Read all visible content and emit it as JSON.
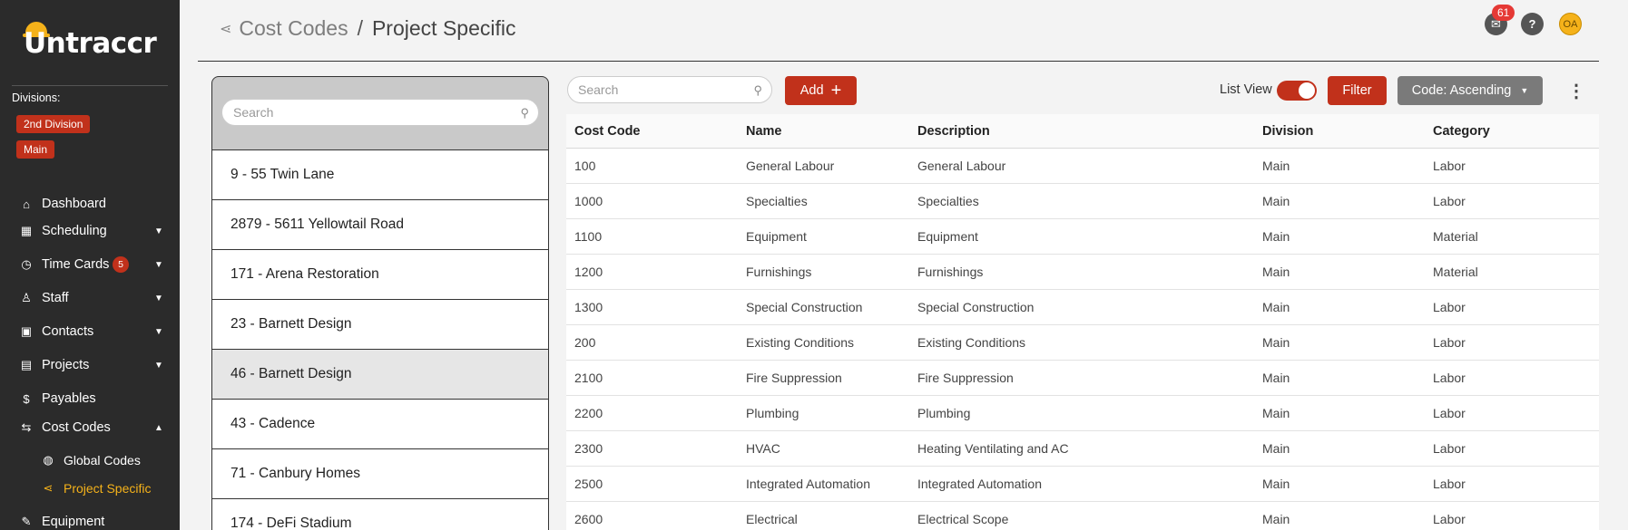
{
  "sidebar": {
    "logo_text": "Untraccr",
    "divisions_label": "Divisions:",
    "divisions": [
      "2nd Division",
      "Main"
    ],
    "nav": [
      {
        "label": "Dashboard",
        "icon": "home-icon"
      },
      {
        "label": "Scheduling",
        "icon": "calendar-icon",
        "expandable": true
      },
      {
        "label": "Time Cards",
        "icon": "clock-icon",
        "badge": "5",
        "expandable": true
      },
      {
        "label": "Staff",
        "icon": "person-icon",
        "expandable": true
      },
      {
        "label": "Contacts",
        "icon": "contacts-icon",
        "expandable": true
      },
      {
        "label": "Projects",
        "icon": "projects-icon",
        "expandable": true
      },
      {
        "label": "Payables",
        "icon": "dollar-icon"
      },
      {
        "label": "Cost Codes",
        "icon": "swap-icon",
        "expanded": true
      },
      {
        "label": "Global Codes",
        "icon": "globe-icon",
        "sub": true
      },
      {
        "label": "Project Specific",
        "icon": "share-icon",
        "sub": true,
        "active": true
      },
      {
        "label": "Equipment",
        "icon": "wrench-icon"
      }
    ]
  },
  "header": {
    "breadcrumb_root": "Cost Codes",
    "breadcrumb_sep": "/",
    "breadcrumb_current": "Project Specific",
    "mail_badge": "61",
    "help_label": "?",
    "avatar_initials": "OA"
  },
  "projects": {
    "search_placeholder": "Search",
    "items": [
      "9 - 55 Twin Lane",
      "2879 - 5611 Yellowtail Road",
      "171 - Arena Restoration",
      "23 - Barnett Design",
      "46 - Barnett Design",
      "43 - Cadence",
      "71 - Canbury Homes",
      "174 - DeFi Stadium"
    ],
    "selected_index": 4
  },
  "toolbar": {
    "search_placeholder": "Search",
    "add_label": "Add",
    "list_view_label": "List View",
    "list_view_on": true,
    "filter_label": "Filter",
    "sort_label": "Code: Ascending"
  },
  "table": {
    "columns": [
      "Cost Code",
      "Name",
      "Description",
      "Division",
      "Category"
    ],
    "rows": [
      [
        "100",
        "General Labour",
        "General Labour",
        "Main",
        "Labor"
      ],
      [
        "1000",
        "Specialties",
        "Specialties",
        "Main",
        "Labor"
      ],
      [
        "1100",
        "Equipment",
        "Equipment",
        "Main",
        "Material"
      ],
      [
        "1200",
        "Furnishings",
        "Furnishings",
        "Main",
        "Material"
      ],
      [
        "1300",
        "Special Construction",
        "Special Construction",
        "Main",
        "Labor"
      ],
      [
        "200",
        "Existing Conditions",
        "Existing Conditions",
        "Main",
        "Labor"
      ],
      [
        "2100",
        "Fire Suppression",
        "Fire Suppression",
        "Main",
        "Labor"
      ],
      [
        "2200",
        "Plumbing",
        "Plumbing",
        "Main",
        "Labor"
      ],
      [
        "2300",
        "HVAC",
        "Heating Ventilating and AC",
        "Main",
        "Labor"
      ],
      [
        "2500",
        "Integrated Automation",
        "Integrated Automation",
        "Main",
        "Labor"
      ],
      [
        "2600",
        "Electrical",
        "Electrical Scope",
        "Main",
        "Labor"
      ]
    ]
  },
  "colors": {
    "accent_red": "#c1311b",
    "accent_yellow": "#f5b21a",
    "sidebar_bg": "#2b2b2b"
  }
}
